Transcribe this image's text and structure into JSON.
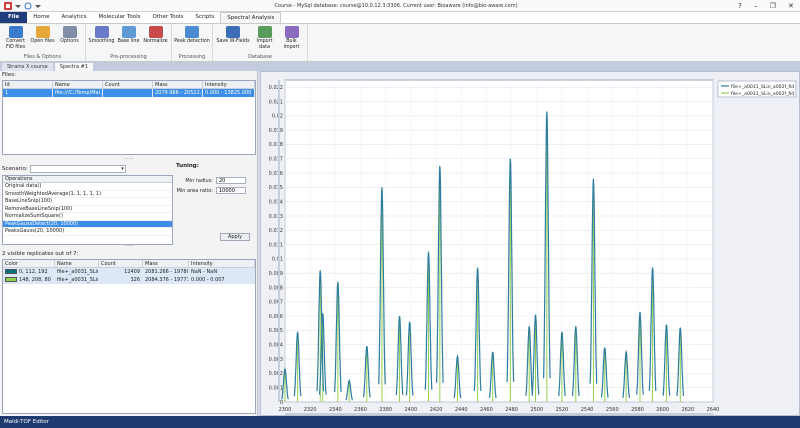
{
  "window": {
    "title": "Course - MySql database: course@10.0.12.3:3306. Current user: Bioaware (info@bio-aware.com)",
    "controls": [
      "?",
      "–",
      "❐",
      "✕"
    ]
  },
  "menu_tabs": [
    "File",
    "Home",
    "Analytics",
    "Molecular Tools",
    "Other Tools",
    "Scripts",
    "Spectral Analysis"
  ],
  "ribbon": {
    "groups": [
      {
        "label": "Files & Options",
        "buttons": [
          {
            "label": "Convert FID files",
            "icon": "convert-icon",
            "color": "#3b7bd0"
          },
          {
            "label": "Open files",
            "icon": "folder-icon",
            "color": "#e6a83a"
          },
          {
            "label": "Options",
            "icon": "options-icon",
            "color": "#7f8fa6"
          }
        ]
      },
      {
        "label": "Pre-processing",
        "buttons": [
          {
            "label": "Smoothing",
            "icon": "smoothing-icon",
            "color": "#6b79c9"
          },
          {
            "label": "Base line",
            "icon": "baseline-icon",
            "color": "#5f9ad6"
          },
          {
            "label": "Normalize",
            "icon": "normalize-icon",
            "color": "#c94a4a"
          }
        ]
      },
      {
        "label": "Processing",
        "buttons": [
          {
            "label": "Peak detection",
            "icon": "peak-detection-icon",
            "color": "#4c8ad1"
          }
        ]
      },
      {
        "label": "Database",
        "buttons": [
          {
            "label": "Save W-Fields",
            "icon": "save-icon",
            "color": "#3c6eb8"
          },
          {
            "label": "Import data",
            "icon": "import-icon",
            "color": "#5a9a5a"
          },
          {
            "label": "Bulk import",
            "icon": "bulk-import-icon",
            "color": "#8a6bbf"
          }
        ]
      }
    ]
  },
  "doc_tabs": [
    "Strains X course",
    "Spectra #1"
  ],
  "files": {
    "label": "Files:",
    "columns": [
      "Id",
      "Name",
      "Count",
      "Mass",
      "Intensity"
    ],
    "rows": [
      {
        "id": "1",
        "name": "file:///C:/Temp/Mal...",
        "count": "",
        "mass": "2079.966 - 20522.974",
        "intensity": "0.000 - 13825.000"
      }
    ]
  },
  "scenario": {
    "label": "Scenario:",
    "value": ""
  },
  "operations": {
    "header": "Operations",
    "items": [
      "Original data()",
      "SmoothWeightedAverage(1, 1, 1, 1, 1)",
      "BaseLineSnip(100)",
      "RemoveBaseLineSnip(100)",
      "NormalizeSumSquare()",
      "PeakGaussDetect(20, 10000)",
      "PeaksGauss(20, 10000)"
    ],
    "selected": 5
  },
  "tuning": {
    "title": "Tuning:",
    "min_radius_label": "Min radius:",
    "min_radius_value": "20",
    "min_area_label": "Min area ratio:",
    "min_area_value": "10000",
    "apply_label": "Apply"
  },
  "replicates": {
    "label": "2 visible replicates out of 7:",
    "columns": [
      "Color",
      "Name",
      "Count",
      "Mass",
      "Intensity"
    ],
    "rows": [
      {
        "color": "#00707f",
        "color_label": "0, 112, 192",
        "name": "file+_a0031_SLin...",
        "count": "12409",
        "mass": "2081.266 - 19780...",
        "intensity": "NaN - NaN"
      },
      {
        "color": "#94d050",
        "color_label": "148, 208, 80",
        "name": "file+_a0031_SLin...",
        "count": "326",
        "mass": "2084.376 - 19773...",
        "intensity": "0.000 - 0.007"
      }
    ]
  },
  "legend": [
    "file+_a0031_SLin_a002f_fid",
    "file+_a0031_SLin_a002f_fid"
  ],
  "chart_data": {
    "type": "line",
    "x_ticks": [
      "2300",
      "2320",
      "2340",
      "2360",
      "2380",
      "2400",
      "2420",
      "2440",
      "2460",
      "2480",
      "2500",
      "2520",
      "2540",
      "2560",
      "2580",
      "2600",
      "2620",
      "2640"
    ],
    "y_ticks": [
      "0",
      "0.001",
      "0.002",
      "0.003",
      "0.004",
      "0.005",
      "0.006",
      "0.007",
      "0.008",
      "0.009",
      "0.01",
      "0.011",
      "0.012",
      "0.013",
      "0.014",
      "0.015",
      "0.016",
      "0.017",
      "0.018",
      "0.019",
      "0.02",
      "0.021",
      "0.022"
    ],
    "xlim": [
      2300,
      2640
    ],
    "ylim": [
      0,
      0.0225
    ],
    "grid": true,
    "legend_position": "top-right",
    "series": [
      {
        "type": "line",
        "color": "#2e7d9e",
        "peaks": [
          [
            2300,
            0.0023
          ],
          [
            2310,
            0.0049
          ],
          [
            2328,
            0.0092
          ],
          [
            2330,
            0.0062
          ],
          [
            2342,
            0.0084
          ],
          [
            2351,
            0.0015
          ],
          [
            2365,
            0.0039
          ],
          [
            2377,
            0.015
          ],
          [
            2391,
            0.006
          ],
          [
            2399,
            0.0056
          ],
          [
            2414,
            0.0105
          ],
          [
            2423,
            0.0165
          ],
          [
            2437,
            0.0032
          ],
          [
            2453,
            0.0094
          ],
          [
            2465,
            0.0035
          ],
          [
            2479,
            0.017
          ],
          [
            2494,
            0.0053
          ],
          [
            2499,
            0.0061
          ],
          [
            2508,
            0.0203
          ],
          [
            2520,
            0.0049
          ],
          [
            2531,
            0.0053
          ],
          [
            2545,
            0.0156
          ],
          [
            2554,
            0.0038
          ],
          [
            2571,
            0.0035
          ],
          [
            2582,
            0.0063
          ],
          [
            2592,
            0.0094
          ],
          [
            2603,
            0.0054
          ],
          [
            2614,
            0.0052
          ]
        ]
      },
      {
        "type": "stick",
        "color": "#94d050"
      }
    ]
  },
  "status": "Maldi-TOF Editor"
}
